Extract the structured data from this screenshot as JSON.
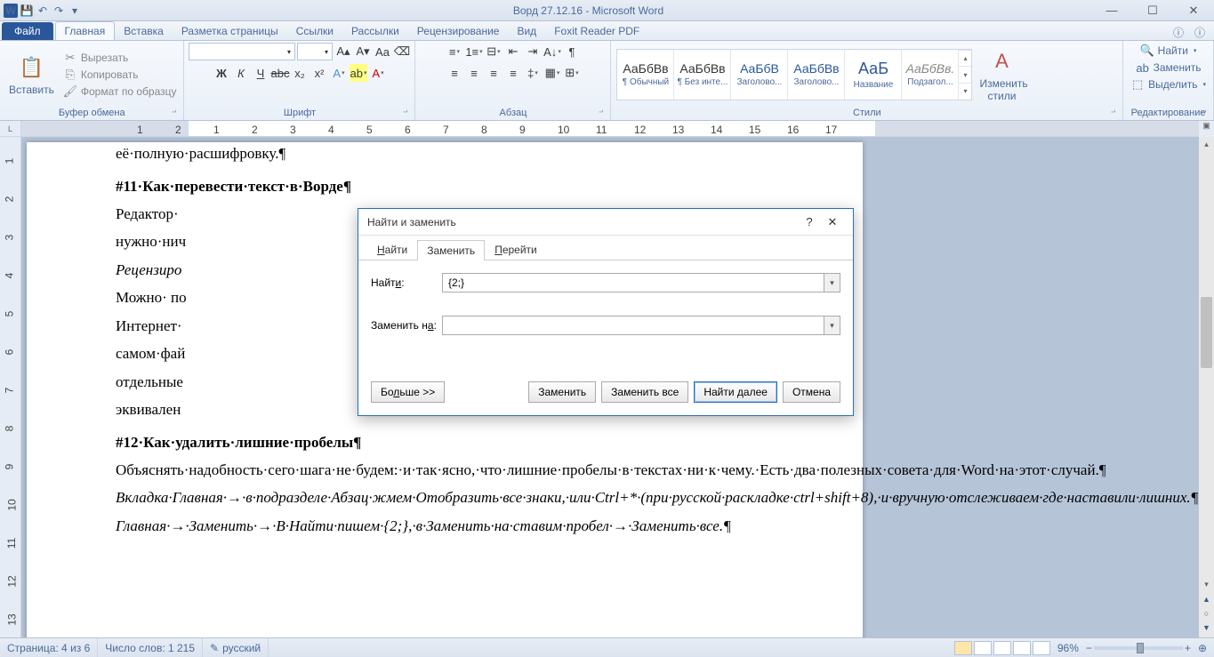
{
  "title": "Ворд 27.12.16 - Microsoft Word",
  "tabs": {
    "file": "Файл",
    "items": [
      "Главная",
      "Вставка",
      "Разметка страницы",
      "Ссылки",
      "Рассылки",
      "Рецензирование",
      "Вид",
      "Foxit Reader PDF"
    ],
    "active": 0
  },
  "ribbon": {
    "clipboard": {
      "label": "Буфер обмена",
      "paste": "Вставить",
      "cut": "Вырезать",
      "copy": "Копировать",
      "format_painter": "Формат по образцу"
    },
    "font": {
      "label": "Шрифт",
      "name": "",
      "size": ""
    },
    "paragraph": {
      "label": "Абзац"
    },
    "styles": {
      "label": "Стили",
      "items": [
        {
          "prev": "АаБбВв",
          "name": "¶ Обычный"
        },
        {
          "prev": "АаБбВв",
          "name": "¶ Без инте..."
        },
        {
          "prev": "АаБбВ",
          "name": "Заголово..."
        },
        {
          "prev": "АаБбВв",
          "name": "Заголово..."
        },
        {
          "prev": "АаБ",
          "name": "Название"
        },
        {
          "prev": "АаБбВв.",
          "name": "Подзагол..."
        }
      ],
      "change": "Изменить стили"
    },
    "editing": {
      "label": "Редактирование",
      "find": "Найти",
      "replace": "Заменить",
      "select": "Выделить"
    }
  },
  "ruler_marks": [
    "1",
    "2",
    "1",
    "2",
    "3",
    "4",
    "5",
    "6",
    "7",
    "8",
    "9",
    "10",
    "11",
    "12",
    "13",
    "14",
    "15",
    "16",
    "17"
  ],
  "vruler_marks": [
    "1",
    "2",
    "3",
    "4",
    "5",
    "6",
    "7",
    "8",
    "9",
    "10",
    "11",
    "12",
    "13"
  ],
  "doc": {
    "p0": "её·полную·расшифровку.",
    "h11": "#11·Как·перевести·текст·в·Ворде",
    "p1a": "Редактор·",
    "p1b": "нужно·нич",
    "p2": "Рецензиро",
    "p3a": "Можно· по",
    "p3b": "Интернет·",
    "p3c": "самом·фай",
    "p3d": "отдельные",
    "p3e": "эквивален",
    "h12": "#12·Как·удалить·лишние·пробелы",
    "p4": "Объяснять·надобность·сего·шага·не·будем:·и·так·ясно,·что·лишние·пробелы·в·текстах·ни·к·чему.·Есть·два·полезных·совета·для·Word·на·этот·случай.",
    "p5": "Вкладка·Главная·→·в·подразделе·Абзац·жмем·Отобразить·все·знаки,·или·Ctrl+*·(при·русской·раскладке·ctrl+shift+8),·и·вручную·отслеживаем·где·наставили·лишних.",
    "p6": "Главная·→·Заменить·→·В·Найти·пишем·{2;},·в·Заменить·на·ставим·пробел·→·Заменить·все."
  },
  "dialog": {
    "title": "Найти и заменить",
    "tabs": {
      "find": "Найти",
      "replace": "Заменить",
      "goto": "Перейти"
    },
    "find_label": "Найти:",
    "find_value": "{2;}",
    "replace_label": "Заменить на:",
    "replace_value": "",
    "more": "Больше >>",
    "replace_btn": "Заменить",
    "replace_all": "Заменить все",
    "find_next": "Найти далее",
    "cancel": "Отмена"
  },
  "status": {
    "page": "Страница: 4 из 6",
    "words": "Число слов: 1 215",
    "lang": "русский",
    "zoom": "96%"
  }
}
